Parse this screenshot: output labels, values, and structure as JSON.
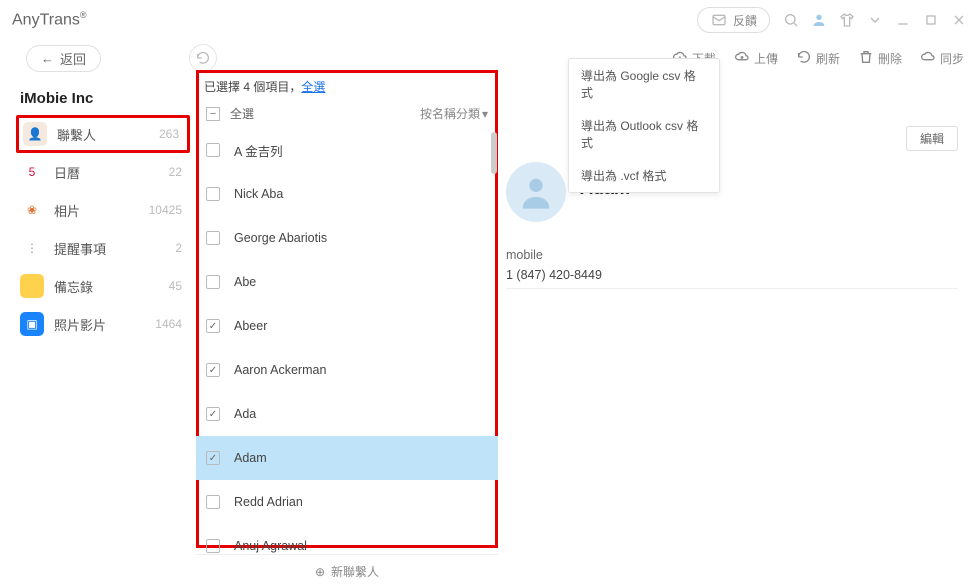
{
  "app": {
    "name": "AnyTrans",
    "reg_mark": "®"
  },
  "titlebar": {
    "feedback_label": "反饋"
  },
  "nav": {
    "back_label": "返回"
  },
  "toolbar": {
    "download": "下載",
    "upload": "上傳",
    "refresh": "刷新",
    "delete": "刪除",
    "sync": "同步"
  },
  "account": "iMobie Inc",
  "sidebar": {
    "items": [
      {
        "label": "聯繫人",
        "count": "263",
        "highlight": true,
        "icon_bg": "#f3e9de",
        "icon_fg": "#c9a77a",
        "glyph": "👤"
      },
      {
        "label": "日曆",
        "count": "22",
        "highlight": false,
        "icon_bg": "#fff",
        "icon_fg": "#d14",
        "glyph": "5"
      },
      {
        "label": "相片",
        "count": "10425",
        "highlight": false,
        "icon_bg": "#fff",
        "icon_fg": "#e07030",
        "glyph": "❀"
      },
      {
        "label": "提醒事項",
        "count": "2",
        "highlight": false,
        "icon_bg": "#fff",
        "icon_fg": "#999",
        "glyph": "⋮"
      },
      {
        "label": "備忘錄",
        "count": "45",
        "highlight": false,
        "icon_bg": "#ffd24d",
        "icon_fg": "#b28300",
        "glyph": ""
      },
      {
        "label": "照片影片",
        "count": "1464",
        "highlight": false,
        "icon_bg": "#1a84ff",
        "icon_fg": "#fff",
        "glyph": "▣"
      }
    ]
  },
  "selection": {
    "status_prefix": "已選擇 ",
    "count": "4",
    "status_suffix": " 個項目，",
    "select_all_link": "全選"
  },
  "list_header": {
    "select_all": "全選",
    "sort_label": "按名稱分類"
  },
  "contacts": [
    {
      "name": "A 金吉列",
      "checked": false,
      "selected": false
    },
    {
      "name": "Nick Aba",
      "checked": false,
      "selected": false
    },
    {
      "name": "George Abariotis",
      "checked": false,
      "selected": false
    },
    {
      "name": "Abe",
      "checked": false,
      "selected": false
    },
    {
      "name": "Abeer",
      "checked": true,
      "selected": false
    },
    {
      "name": "Aaron Ackerman",
      "checked": true,
      "selected": false
    },
    {
      "name": "Ada",
      "checked": true,
      "selected": false
    },
    {
      "name": "Adam",
      "checked": true,
      "selected": true
    },
    {
      "name": "Redd Adrian",
      "checked": false,
      "selected": false
    },
    {
      "name": "Anuj Agrawal",
      "checked": false,
      "selected": false
    }
  ],
  "footer": {
    "add_contact": "新聯繫人"
  },
  "detail": {
    "edit": "編輯",
    "name": "Adam",
    "field_label": "mobile",
    "field_value": "1 (847) 420-8449"
  },
  "dropdown": {
    "items": [
      "導出為 Google csv 格式",
      "導出為 Outlook csv 格式",
      "導出為 .vcf 格式"
    ]
  }
}
